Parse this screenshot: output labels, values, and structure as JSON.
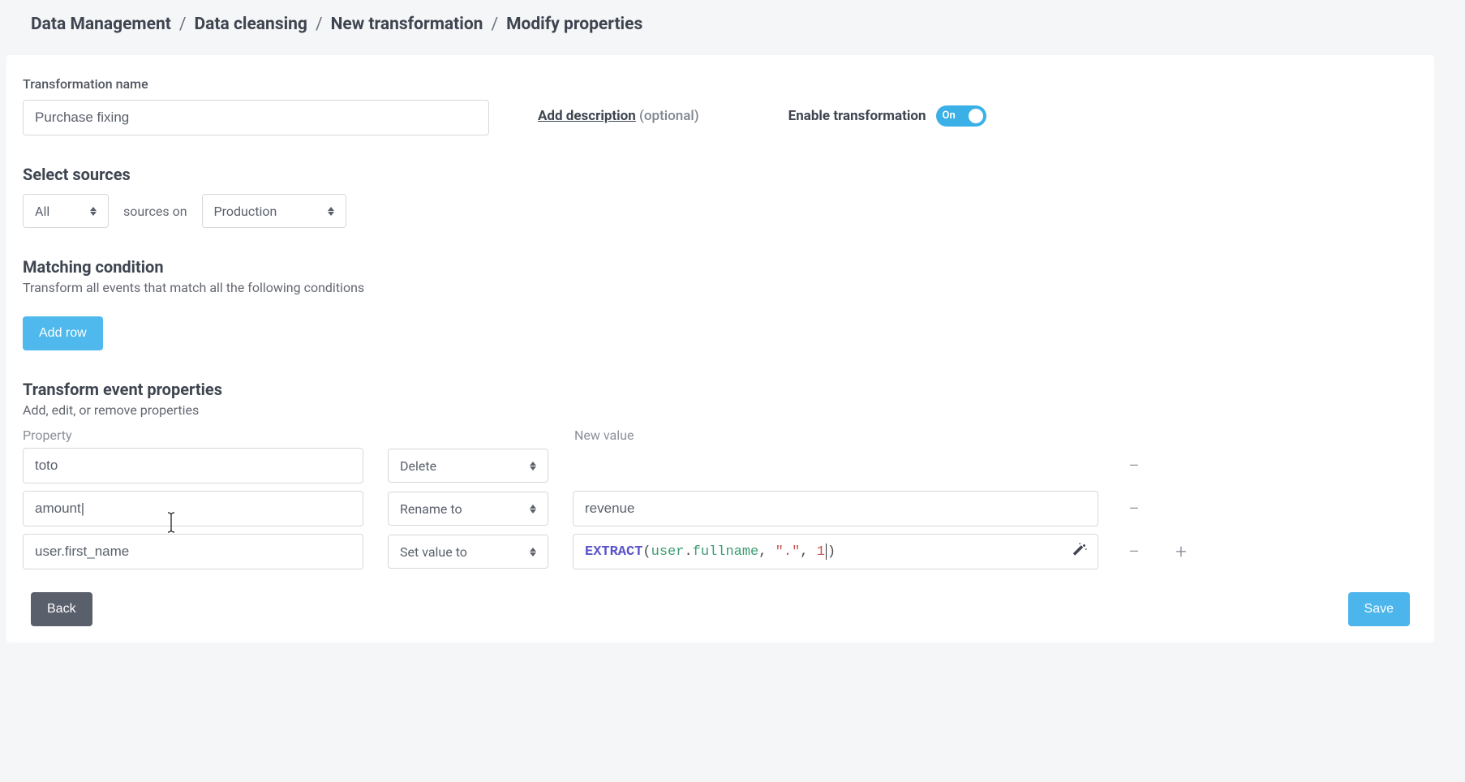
{
  "breadcrumb": {
    "c1": "Data Management",
    "c2": "Data cleansing",
    "c3": "New transformation",
    "c4": "Modify properties",
    "sep": "/"
  },
  "labels": {
    "transformation_name": "Transformation name",
    "add_description": "Add description",
    "optional": "(optional)",
    "enable_transformation": "Enable transformation",
    "toggle_state": "On",
    "select_sources": "Select sources",
    "sources_on": "sources on",
    "matching_condition": "Matching condition",
    "matching_sub": "Transform all events that match all the following conditions",
    "add_row": "Add row",
    "transform_props": "Transform event properties",
    "transform_sub": "Add, edit, or remove properties",
    "col_property": "Property",
    "col_new_value": "New value",
    "back": "Back",
    "save": "Save"
  },
  "values": {
    "transformation_name": "Purchase fixing",
    "source_scope": "All",
    "source_env": "Production"
  },
  "rows": [
    {
      "property": "toto",
      "action": "Delete",
      "value": ""
    },
    {
      "property": "amount|",
      "action": "Rename to",
      "value": "revenue"
    },
    {
      "property": "user.first_name",
      "action": "Set value to",
      "value_expr": true
    }
  ],
  "expression": {
    "fn": "EXTRACT",
    "arg1a": "user",
    "arg1b": "fullname",
    "arg2": "\".\"",
    "arg3": "1"
  }
}
